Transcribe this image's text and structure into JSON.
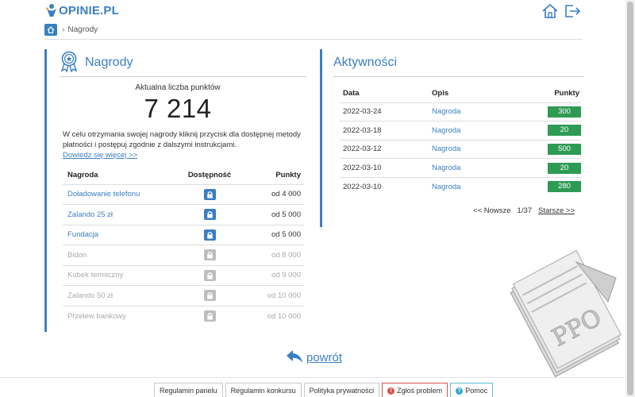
{
  "header": {
    "logo_text": "OPINIE.PL",
    "home_icon": "home-icon",
    "logout_icon": "logout-icon"
  },
  "breadcrumb": {
    "home_icon": "home-icon",
    "separator": "›",
    "current": "Nagrody"
  },
  "rewards": {
    "title": "Nagrody",
    "icon": "award-ribbon-icon",
    "points_label": "Aktualna liczba punktów",
    "points_value": "7 214",
    "instructions": "W celu otrzymania swojej nagrody kliknij przycisk dla dostępnej metody płatności i postępuj zgodnie z dalszymi instrukcjami.",
    "more_link": "Dowiedz się więcej >>",
    "columns": {
      "name": "Nagroda",
      "availability": "Dostępność",
      "points": "Punkty"
    },
    "items": [
      {
        "name": "Doładowanie telefonu",
        "points": "od 4 000",
        "available": true
      },
      {
        "name": "Zalando 25 zł",
        "points": "od 5 000",
        "available": true
      },
      {
        "name": "Fundacja",
        "points": "od 5 000",
        "available": true
      },
      {
        "name": "Bidon",
        "points": "od 8 000",
        "available": false
      },
      {
        "name": "Kubek termiczny",
        "points": "od 9 000",
        "available": false
      },
      {
        "name": "Zalando 50 zł",
        "points": "od 10 000",
        "available": false
      },
      {
        "name": "Przelew bankowy",
        "points": "od 10 000",
        "available": false
      }
    ]
  },
  "activity": {
    "title": "Aktywności",
    "columns": {
      "date": "Data",
      "desc": "Opis",
      "points": "Punkty"
    },
    "rows": [
      {
        "date": "2022-03-24",
        "desc": "Nagroda",
        "points": "300"
      },
      {
        "date": "2022-03-18",
        "desc": "Nagroda",
        "points": "20"
      },
      {
        "date": "2022-03-12",
        "desc": "Nagroda",
        "points": "500"
      },
      {
        "date": "2022-03-10",
        "desc": "Nagroda",
        "points": "20"
      },
      {
        "date": "2022-03-10",
        "desc": "Nagroda",
        "points": "280"
      }
    ],
    "pager": {
      "prev": "<< Nowsze",
      "page": "1/37",
      "next": "Starsze >>"
    }
  },
  "back": {
    "label": "powrót",
    "icon": "back-arrow-icon"
  },
  "footer": {
    "links": [
      {
        "label": "Regulamin panelu"
      },
      {
        "label": "Regulamin konkursu"
      },
      {
        "label": "Polityka prywatności"
      },
      {
        "label": "Zgłoś problem",
        "icon": "alert-icon"
      },
      {
        "label": "Pomoc",
        "icon": "help-icon"
      }
    ]
  },
  "stamp": {
    "text": "PPO"
  },
  "colors": {
    "accent": "#3a7fc1",
    "badge_green": "#2e9b55",
    "disabled": "#bdbdbd",
    "report_red": "#d9534f",
    "help_teal": "#31a8c8"
  }
}
